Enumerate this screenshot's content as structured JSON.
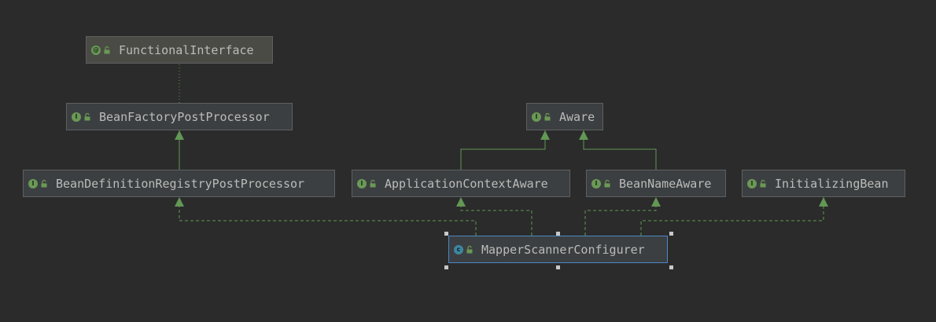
{
  "diagram": {
    "nodes": {
      "functional_interface": {
        "label": "FunctionalInterface",
        "kind": "annotation",
        "icon": "annotation-icon",
        "badge": "@"
      },
      "bean_factory_post_processor": {
        "label": "BeanFactoryPostProcessor",
        "kind": "interface",
        "icon": "interface-icon",
        "badge": "I"
      },
      "aware": {
        "label": "Aware",
        "kind": "interface",
        "icon": "interface-icon",
        "badge": "I"
      },
      "bean_definition_registry_post_processor": {
        "label": "BeanDefinitionRegistryPostProcessor",
        "kind": "interface",
        "icon": "interface-icon",
        "badge": "I"
      },
      "application_context_aware": {
        "label": "ApplicationContextAware",
        "kind": "interface",
        "icon": "interface-icon",
        "badge": "I"
      },
      "bean_name_aware": {
        "label": "BeanNameAware",
        "kind": "interface",
        "icon": "interface-icon",
        "badge": "I"
      },
      "initializing_bean": {
        "label": "InitializingBean",
        "kind": "interface",
        "icon": "interface-icon",
        "badge": "I"
      },
      "mapper_scanner_configurer": {
        "label": "MapperScannerConfigurer",
        "kind": "class",
        "icon": "class-icon",
        "badge": "c",
        "selected": true
      }
    },
    "edges": [
      {
        "from": "bean_factory_post_processor",
        "to": "functional_interface",
        "type": "annotation"
      },
      {
        "from": "bean_definition_registry_post_processor",
        "to": "bean_factory_post_processor",
        "type": "extends"
      },
      {
        "from": "application_context_aware",
        "to": "aware",
        "type": "extends"
      },
      {
        "from": "bean_name_aware",
        "to": "aware",
        "type": "extends"
      },
      {
        "from": "mapper_scanner_configurer",
        "to": "bean_definition_registry_post_processor",
        "type": "implements"
      },
      {
        "from": "mapper_scanner_configurer",
        "to": "application_context_aware",
        "type": "implements"
      },
      {
        "from": "mapper_scanner_configurer",
        "to": "bean_name_aware",
        "type": "implements"
      },
      {
        "from": "mapper_scanner_configurer",
        "to": "initializing_bean",
        "type": "implements"
      }
    ]
  },
  "colors": {
    "background": "#2b2b2b",
    "node_fill": "#3c3f41",
    "node_border": "#5e6060",
    "text": "#bbbbbb",
    "edge": "#629755",
    "selection": "#4a88c7"
  }
}
